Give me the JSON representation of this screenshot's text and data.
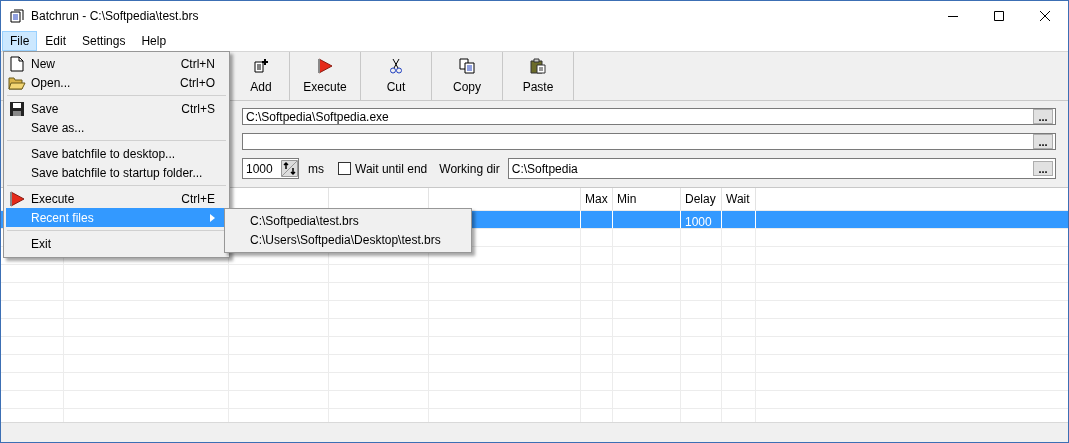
{
  "window": {
    "title": "Batchrun - C:\\Softpedia\\test.brs"
  },
  "menubar": [
    {
      "label": "File",
      "selected": true
    },
    {
      "label": "Edit",
      "selected": false
    },
    {
      "label": "Settings",
      "selected": false
    },
    {
      "label": "Help",
      "selected": false
    }
  ],
  "toolbar": [
    {
      "kind": "add",
      "label": "Add"
    },
    {
      "kind": "execute",
      "label": "Execute"
    },
    {
      "kind": "cut",
      "label": "Cut"
    },
    {
      "kind": "copy",
      "label": "Copy"
    },
    {
      "kind": "paste",
      "label": "Paste"
    }
  ],
  "form": {
    "program": {
      "value": "C:\\Softpedia\\Softpedia.exe",
      "browse": "..."
    },
    "parameters": {
      "browse": "..."
    },
    "delay": {
      "value": "1000",
      "unit": "ms"
    },
    "wait_until_end": {
      "label": "Wait until end",
      "checked": false
    },
    "working_dir": {
      "label": "Working dir",
      "value": "C:\\Softpedia",
      "browse": "..."
    }
  },
  "table": {
    "columns": [
      {
        "label": "Max"
      },
      {
        "label": "Min"
      },
      {
        "label": "Delay"
      },
      {
        "label": "Wait"
      }
    ],
    "rows": [
      {
        "selected": true,
        "delay": "1000"
      }
    ]
  },
  "file_menu": [
    {
      "kind": "new",
      "label": "New",
      "shortcut": "Ctrl+N",
      "selected": false
    },
    {
      "kind": "open",
      "label": "Open...",
      "shortcut": "Ctrl+O",
      "selected": false
    },
    {
      "kind": "separator"
    },
    {
      "kind": "save",
      "label": "Save",
      "shortcut": "Ctrl+S",
      "selected": false
    },
    {
      "kind": "item",
      "label": "Save as...",
      "selected": false
    },
    {
      "kind": "separator"
    },
    {
      "kind": "item",
      "label": "Save batchfile to desktop...",
      "selected": false
    },
    {
      "kind": "item",
      "label": "Save batchfile to startup folder...",
      "selected": false
    },
    {
      "kind": "separator"
    },
    {
      "kind": "execute",
      "label": "Execute",
      "shortcut": "Ctrl+E",
      "selected": false
    },
    {
      "kind": "submenu",
      "label": "Recent files",
      "selected": true
    },
    {
      "kind": "separator"
    },
    {
      "kind": "item",
      "label": "Exit",
      "selected": false
    }
  ],
  "recent_files_menu": [
    {
      "label": "C:\\Softpedia\\test.brs"
    },
    {
      "label": "C:\\Users\\Softpedia\\Desktop\\test.brs"
    }
  ]
}
